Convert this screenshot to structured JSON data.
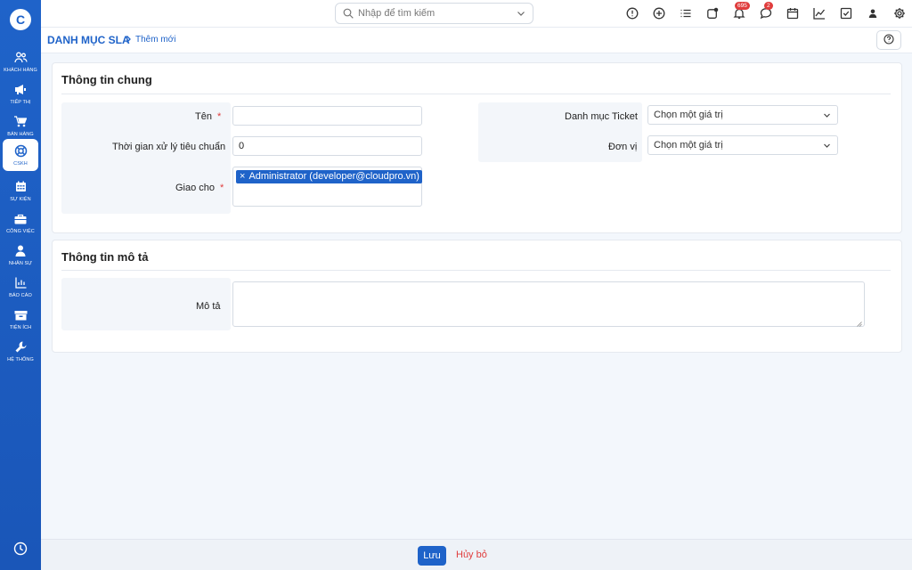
{
  "app": {
    "logo": "C"
  },
  "sidebar": {
    "items": [
      {
        "label": "Khách hàng",
        "icon": "users-icon"
      },
      {
        "label": "Tiếp thị",
        "icon": "megaphone-icon"
      },
      {
        "label": "Bán hàng",
        "icon": "cart-icon"
      },
      {
        "label": "CSKH",
        "icon": "lifebuoy-icon",
        "active": true
      },
      {
        "label": "Sự kiện",
        "icon": "calendar-icon"
      },
      {
        "label": "Công việc",
        "icon": "briefcase-icon"
      },
      {
        "label": "Nhân sự",
        "icon": "person-icon"
      },
      {
        "label": "Báo cáo",
        "icon": "chart-icon"
      },
      {
        "label": "Tiện ích",
        "icon": "box-icon"
      },
      {
        "label": "Hệ thống",
        "icon": "wrench-icon"
      }
    ],
    "bottom_icon": "clock-icon"
  },
  "topbar": {
    "search": {
      "placeholder": "Nhập để tìm kiếm"
    },
    "icons": [
      "alert-icon",
      "add-circle-icon",
      "list-icon",
      "external-icon",
      "bell-icon",
      "chat-icon",
      "calendar-icon",
      "trend-icon",
      "checkbox-icon",
      "user-icon",
      "settings-icon"
    ],
    "notifications_badge": "695",
    "chat_badge": "2"
  },
  "breadcrumb": {
    "main": "DANH MỤC SLA",
    "sub": "Thêm mới"
  },
  "general": {
    "title": "Thông tin chung",
    "name_label": "Tên",
    "name_value": "",
    "time_label": "Thời gian xử lý tiêu chuẩn",
    "time_value": "0",
    "assign_label": "Giao cho",
    "assign_tag": "Administrator (developer@cloudpro.vn)",
    "ticket_category_label": "Danh mục Ticket",
    "ticket_category_value": "Chọn một giá trị",
    "unit_label": "Đơn vị",
    "unit_value": "Chọn một giá trị",
    "required_mark": "*"
  },
  "description": {
    "title": "Thông tin mô tả",
    "desc_label": "Mô tả",
    "desc_value": ""
  },
  "footer": {
    "save_label": "Lưu",
    "cancel_label": "Hủy bỏ"
  },
  "colors": {
    "primary": "#1f63c9",
    "danger": "#e03c3c",
    "background": "#f3f7fc"
  }
}
